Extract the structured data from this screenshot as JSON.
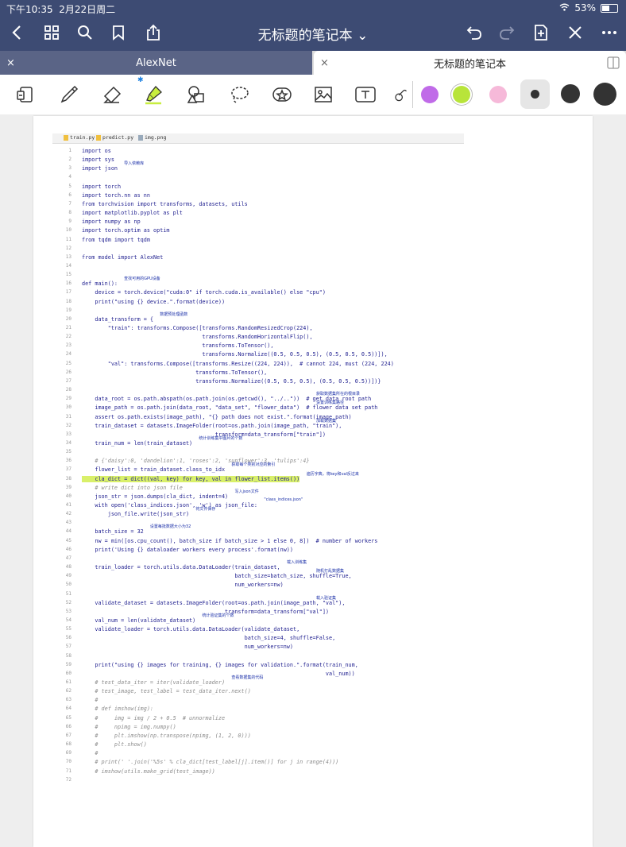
{
  "status": {
    "time": "下午10:35",
    "date": "2月22日周二",
    "battery": "53%",
    "battery_level": 0.53
  },
  "nav": {
    "title": "无标题的笔记本",
    "icons": [
      "back-icon",
      "grid-icon",
      "search-icon",
      "bookmark-icon",
      "share-icon",
      "undo-icon",
      "redo-icon",
      "add-page-icon",
      "close-icon",
      "more-icon"
    ]
  },
  "tabs": [
    {
      "label": "AlexNet",
      "close": "×"
    },
    {
      "label": "无标题的笔记本",
      "close": "×"
    }
  ],
  "toolbar": {
    "tools": [
      "lasso-select-icon",
      "pen-icon",
      "eraser-icon",
      "highlighter-icon",
      "shapes-icon",
      "lasso-icon",
      "sticker-icon",
      "image-icon",
      "text-icon",
      "link-icon"
    ],
    "colors": [
      "#c06be8",
      "#b8e43a",
      "#f6b9d9"
    ],
    "sizes": [
      "small-dot",
      "medium-dot",
      "large-dot"
    ]
  },
  "editor": {
    "tabs": [
      "train.py",
      "predict.py",
      "img.png"
    ],
    "lines": [
      "import os",
      "import sys",
      "import json",
      "",
      "import torch",
      "import torch.nn as nn",
      "from torchvision import transforms, datasets, utils",
      "import matplotlib.pyplot as plt",
      "import numpy as np",
      "import torch.optim as optim",
      "from tqdm import tqdm",
      "",
      "from model import AlexNet",
      "",
      "",
      "def main():",
      "    device = torch.device(\"cuda:0\" if torch.cuda.is_available() else \"cpu\")",
      "    print(\"using {} device.\".format(device))",
      "",
      "    data_transform = {",
      "        \"train\": transforms.Compose([transforms.RandomResizedCrop(224),",
      "                                     transforms.RandomHorizontalFlip(),",
      "                                     transforms.ToTensor(),",
      "                                     transforms.Normalize((0.5, 0.5, 0.5), (0.5, 0.5, 0.5))]),",
      "        \"val\": transforms.Compose([transforms.Resize((224, 224)),  # cannot 224, must (224, 224)",
      "                                   transforms.ToTensor(),",
      "                                   transforms.Normalize((0.5, 0.5, 0.5), (0.5, 0.5, 0.5))])}",
      "",
      "    data_root = os.path.abspath(os.path.join(os.getcwd(), \"../..\"))  # get data root path",
      "    image_path = os.path.join(data_root, \"data_set\", \"flower_data\")  # flower data set path",
      "    assert os.path.exists(image_path), \"{} path does not exist.\".format(image_path)",
      "    train_dataset = datasets.ImageFolder(root=os.path.join(image_path, \"train\"),",
      "                                         transform=data_transform[\"train\"])",
      "    train_num = len(train_dataset)",
      "",
      "    # {'daisy':0, 'dandelion':1, 'roses':2, 'sunflower':3, 'tulips':4}",
      "    flower_list = train_dataset.class_to_idx",
      "    cla_dict = dict((val, key) for key, val in flower_list.items())",
      "    # write dict into json file",
      "    json_str = json.dumps(cla_dict, indent=4)",
      "    with open('class_indices.json', 'w') as json_file:",
      "        json_file.write(json_str)",
      "",
      "    batch_size = 32",
      "    nw = min([os.cpu_count(), batch_size if batch_size > 1 else 0, 8])  # number of workers",
      "    print('Using {} dataloader workers every process'.format(nw))",
      "",
      "    train_loader = torch.utils.data.DataLoader(train_dataset,",
      "                                               batch_size=batch_size, shuffle=True,",
      "                                               num_workers=nw)",
      "",
      "    validate_dataset = datasets.ImageFolder(root=os.path.join(image_path, \"val\"),",
      "                                            transform=data_transform[\"val\"])",
      "    val_num = len(validate_dataset)",
      "    validate_loader = torch.utils.data.DataLoader(validate_dataset,",
      "                                                  batch_size=4, shuffle=False,",
      "                                                  num_workers=nw)",
      "",
      "    print(\"using {} images for training, {} images for validation.\".format(train_num,",
      "                                                                           val_num))",
      "    # test_data_iter = iter(validate_loader)",
      "    # test_image, test_label = test_data_iter.next()",
      "    #",
      "    # def imshow(img):",
      "    #     img = img / 2 + 0.5  # unnormalize",
      "    #     npimg = img.numpy()",
      "    #     plt.imshow(np.transpose(npimg, (1, 2, 0)))",
      "    #     plt.show()",
      "    #",
      "    # print(' '.join('%5s' % cla_dict[test_label[j].item()] for j in range(4)))",
      "    # imshow(utils.make_grid(test_image))",
      ""
    ]
  },
  "annotations": [
    {
      "text": "导入依赖库",
      "line": 3
    },
    {
      "text": "查找可用的GPU设备",
      "line": 16
    },
    {
      "text": "数据预处理函数",
      "line": 20
    },
    {
      "text": "获取数据集所在的根目录",
      "line": 29
    },
    {
      "text": "设置训练集路径",
      "line": 30
    },
    {
      "text": "加载数据集",
      "line": 32
    },
    {
      "text": "统计训练集中图片的个数",
      "line": 34
    },
    {
      "text": "获取每个类别对应的索引",
      "line": 37
    },
    {
      "text": "遍历字典，将key和val反过来",
      "line": 38
    },
    {
      "text": "写入json文件",
      "line": 40
    },
    {
      "text": "\"class_indices.json\"",
      "line": 41
    },
    {
      "text": "将文件保存",
      "line": 42
    },
    {
      "text": "设置每批数据大小为32",
      "line": 44
    },
    {
      "text": "载入训练集",
      "line": 48
    },
    {
      "text": "随机打乱数据集",
      "line": 49
    },
    {
      "text": "载入验证集",
      "line": 52
    },
    {
      "text": "统计验证集的个数",
      "line": 54
    },
    {
      "text": "查看数据集的代码",
      "line": 61
    }
  ]
}
